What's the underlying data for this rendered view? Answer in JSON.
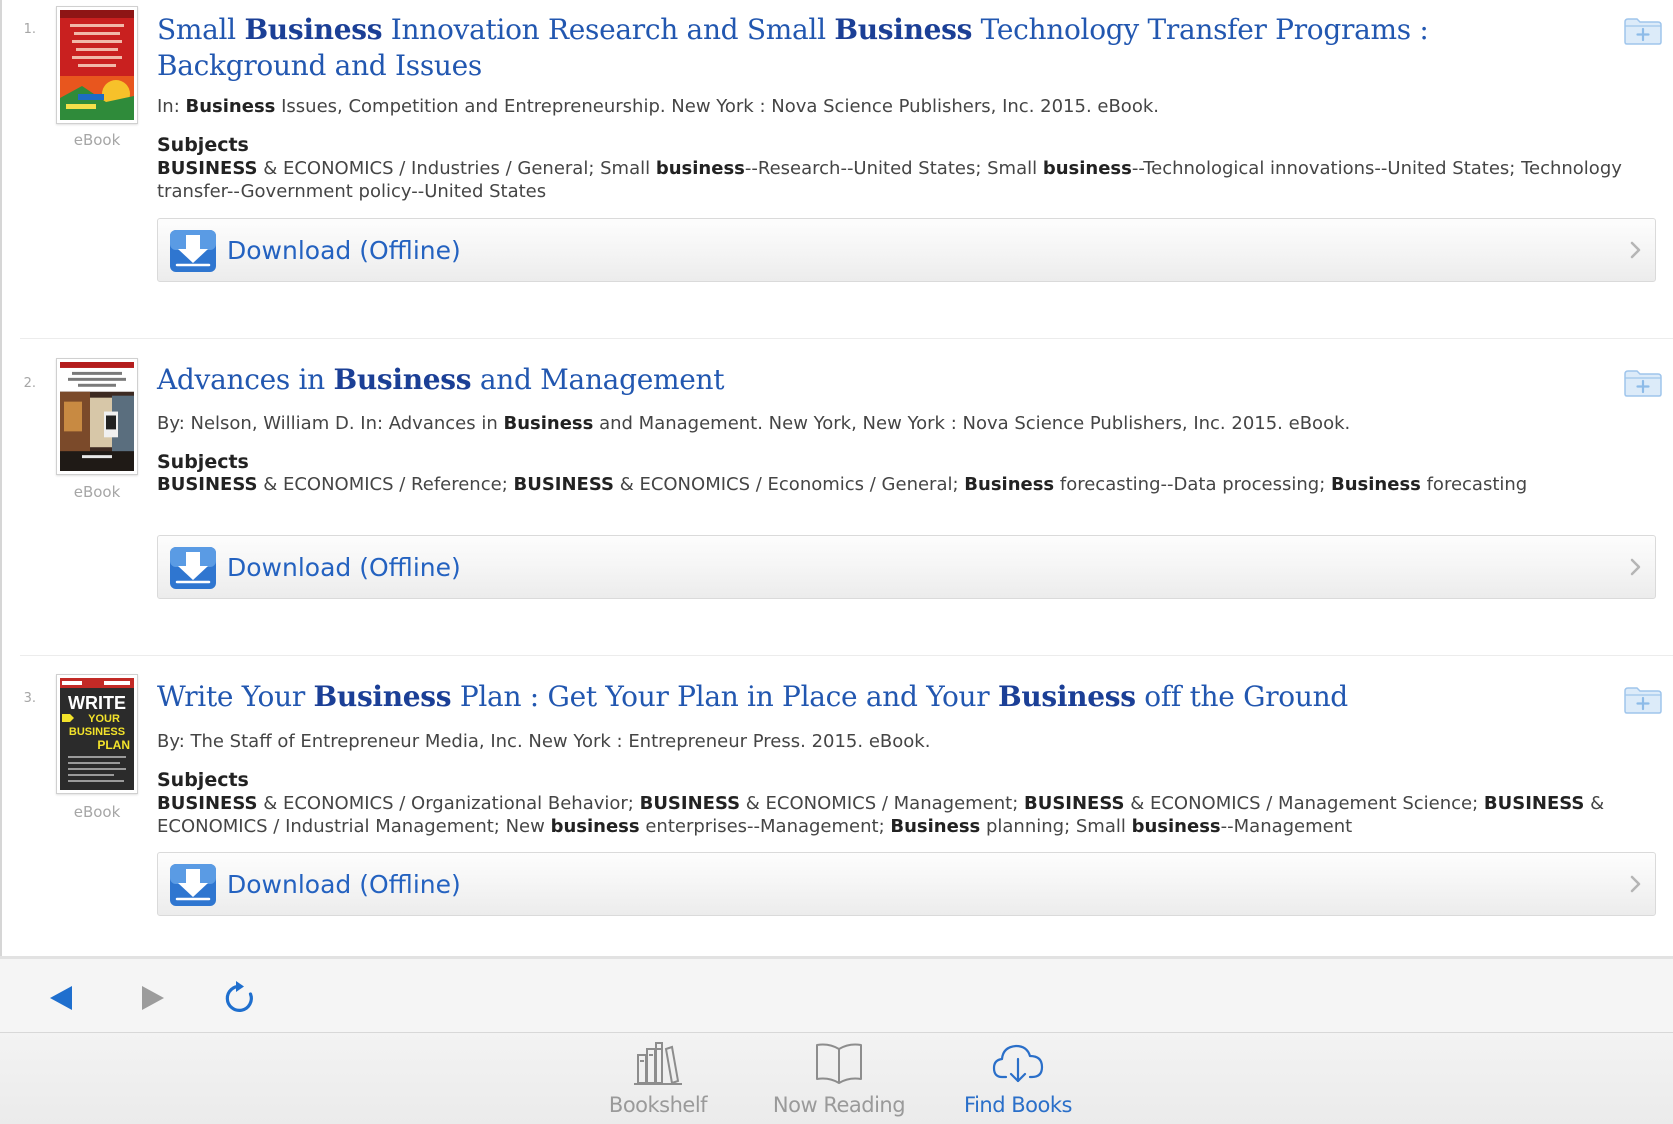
{
  "results": [
    {
      "number": "1.",
      "format": "eBook",
      "title": [
        {
          "t": "Small ",
          "b": false
        },
        {
          "t": "Business",
          "b": true
        },
        {
          "t": " Innovation Research and Small ",
          "b": false
        },
        {
          "t": "Business",
          "b": true
        },
        {
          "t": " Technology Transfer Programs : Background and Issues",
          "b": false
        }
      ],
      "meta": [
        {
          "t": "In: ",
          "b": false
        },
        {
          "t": "Business",
          "b": true
        },
        {
          "t": " Issues, Competition and Entrepreneurship. New York : Nova Science Publishers, Inc. 2015. eBook.",
          "b": false
        }
      ],
      "subjects_heading": "Subjects",
      "subjects": [
        {
          "t": "BUSINESS",
          "b": true
        },
        {
          "t": " & ECONOMICS / Industries / General; Small ",
          "b": false
        },
        {
          "t": "business",
          "b": true
        },
        {
          "t": "--Research--United States; Small ",
          "b": false
        },
        {
          "t": "business",
          "b": true
        },
        {
          "t": "--Technological innovations--United States; Technology transfer--Government policy--United States",
          "b": false
        }
      ],
      "download_label": "Download (Offline)",
      "cover_icon": "book-cover-red"
    },
    {
      "number": "2.",
      "format": "eBook",
      "title": [
        {
          "t": "Advances in ",
          "b": false
        },
        {
          "t": "Business",
          "b": true
        },
        {
          "t": " and Management",
          "b": false
        }
      ],
      "meta": [
        {
          "t": "By: Nelson, William D. In: Advances in ",
          "b": false
        },
        {
          "t": "Business",
          "b": true
        },
        {
          "t": " and Management. New York, New York : Nova Science Publishers, Inc. 2015. eBook.",
          "b": false
        }
      ],
      "subjects_heading": "Subjects",
      "subjects": [
        {
          "t": "BUSINESS",
          "b": true
        },
        {
          "t": " & ECONOMICS / Reference; ",
          "b": false
        },
        {
          "t": "BUSINESS",
          "b": true
        },
        {
          "t": " & ECONOMICS / Economics / General; ",
          "b": false
        },
        {
          "t": "Business",
          "b": true
        },
        {
          "t": " forecasting--Data processing; ",
          "b": false
        },
        {
          "t": "Business",
          "b": true
        },
        {
          "t": " forecasting",
          "b": false
        }
      ],
      "download_label": "Download (Offline)",
      "cover_icon": "book-cover-photo"
    },
    {
      "number": "3.",
      "format": "eBook",
      "title": [
        {
          "t": "Write Your ",
          "b": false
        },
        {
          "t": "Business",
          "b": true
        },
        {
          "t": " Plan : Get Your Plan in Place and Your ",
          "b": false
        },
        {
          "t": "Business",
          "b": true
        },
        {
          "t": " off the Ground",
          "b": false
        }
      ],
      "meta": [
        {
          "t": "By: The Staff of Entrepreneur Media, Inc. New York : Entrepreneur Press. 2015. eBook.",
          "b": false
        }
      ],
      "subjects_heading": "Subjects",
      "subjects": [
        {
          "t": "BUSINESS",
          "b": true
        },
        {
          "t": " & ECONOMICS / Organizational Behavior; ",
          "b": false
        },
        {
          "t": "BUSINESS",
          "b": true
        },
        {
          "t": " & ECONOMICS / Management; ",
          "b": false
        },
        {
          "t": "BUSINESS",
          "b": true
        },
        {
          "t": " & ECONOMICS / Management Science; ",
          "b": false
        },
        {
          "t": "BUSINESS",
          "b": true
        },
        {
          "t": " & ECONOMICS / Industrial Management; New ",
          "b": false
        },
        {
          "t": "business",
          "b": true
        },
        {
          "t": " enterprises--Management; ",
          "b": false
        },
        {
          "t": "Business",
          "b": true
        },
        {
          "t": " planning; Small ",
          "b": false
        },
        {
          "t": "business",
          "b": true
        },
        {
          "t": "--Management",
          "b": false
        }
      ],
      "download_label": "Download (Offline)",
      "cover_icon": "book-cover-write-your-business-plan",
      "cover_text": [
        "WRITE",
        "YOUR",
        "BUSINESS",
        "PLAN"
      ]
    }
  ],
  "navigation": {
    "back_icon": "back-arrow-icon",
    "forward_icon": "forward-arrow-icon",
    "refresh_icon": "refresh-icon"
  },
  "tabs": [
    {
      "label": "Bookshelf",
      "icon": "bookshelf-icon",
      "active": false
    },
    {
      "label": "Now Reading",
      "icon": "open-book-icon",
      "active": false
    },
    {
      "label": "Find Books",
      "icon": "cloud-download-icon",
      "active": true
    }
  ],
  "colors": {
    "link_blue": "#2257b0",
    "active_tab_blue": "#2a6fc9",
    "inactive_tab_gray": "#9a9a9a",
    "text_gray": "#454545"
  }
}
